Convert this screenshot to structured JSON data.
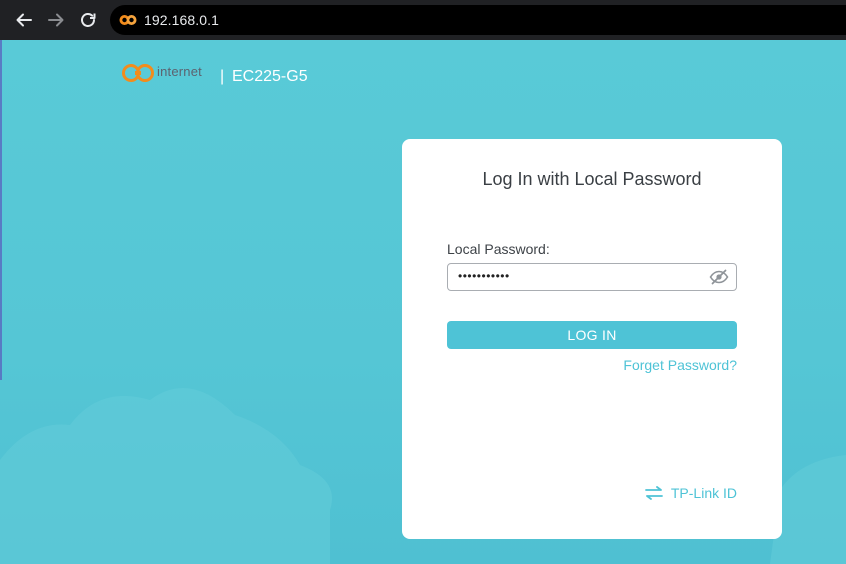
{
  "browser": {
    "url": "192.168.0.1",
    "back_icon": "arrow-left-icon",
    "forward_icon": "arrow-right-icon",
    "reload_icon": "reload-icon"
  },
  "brand": {
    "logo_text": "internet",
    "separator": "|",
    "model": "EC225-G5"
  },
  "login": {
    "title": "Log In with Local Password",
    "password_label": "Local Password:",
    "password_value": "•••••••••••",
    "eye_icon": "eye-slash-icon",
    "button_label": "LOG IN",
    "forget_link": "Forget Password?",
    "tplink_label": "TP-Link ID",
    "tplink_icon": "swap-arrows-icon"
  },
  "colors": {
    "background": "#56c8d6",
    "accent": "#4ec3d6",
    "card": "#ffffff",
    "toolbar": "#202124"
  }
}
